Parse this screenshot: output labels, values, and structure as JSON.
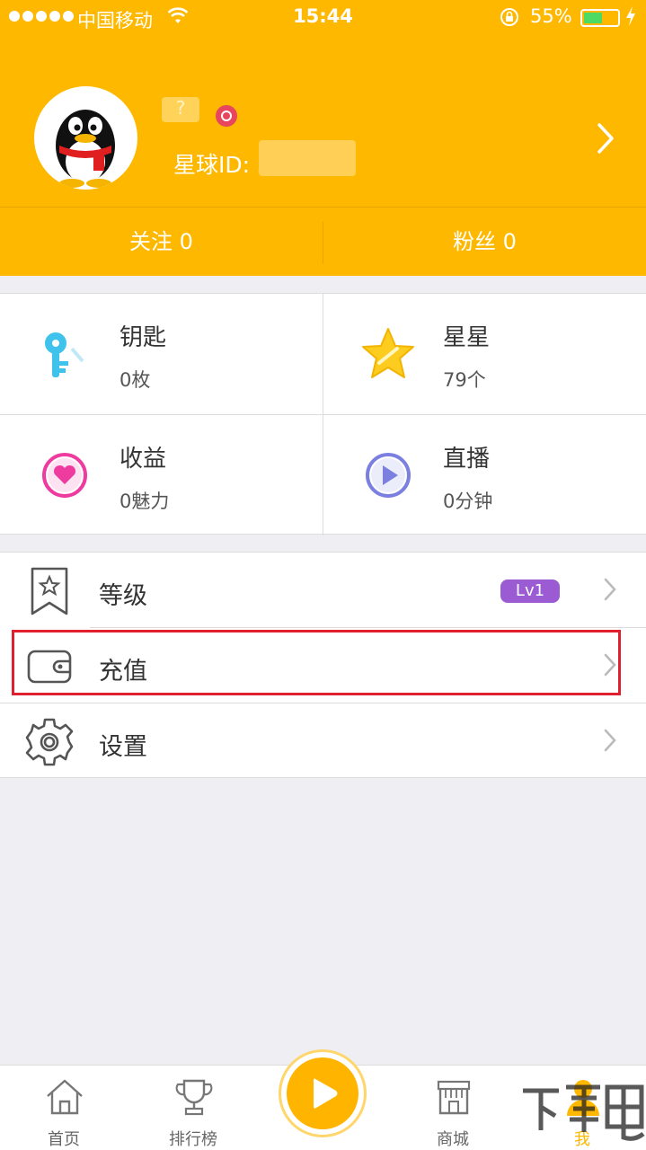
{
  "status_bar": {
    "carrier": "中国移动",
    "time": "15:44",
    "battery_percent": "55%",
    "battery_level": 0.55
  },
  "profile": {
    "nickname_blurred": "?",
    "planet_id_label": "星球ID: 3",
    "avatar_icon": "qq-penguin-avatar"
  },
  "follow": {
    "following": "关注 0",
    "fans": "粉丝 0"
  },
  "stats": [
    {
      "title": "钥匙",
      "value": "0枚",
      "icon": "key-icon"
    },
    {
      "title": "星星",
      "value": "79个",
      "icon": "star-icon"
    },
    {
      "title": "收益",
      "value": "0魅力",
      "icon": "heart-icon"
    },
    {
      "title": "直播",
      "value": "0分钟",
      "icon": "play-icon"
    }
  ],
  "menu": {
    "level": {
      "label": "等级",
      "badge": "Lv1"
    },
    "recharge": {
      "label": "充值"
    },
    "settings": {
      "label": "设置"
    }
  },
  "tabs": {
    "home": "首页",
    "ranking": "排行榜",
    "shop": "商城",
    "me": "我"
  },
  "colors": {
    "brand": "#ffb800",
    "level_badge": "#9a5bd3",
    "highlight": "#e0202e"
  }
}
